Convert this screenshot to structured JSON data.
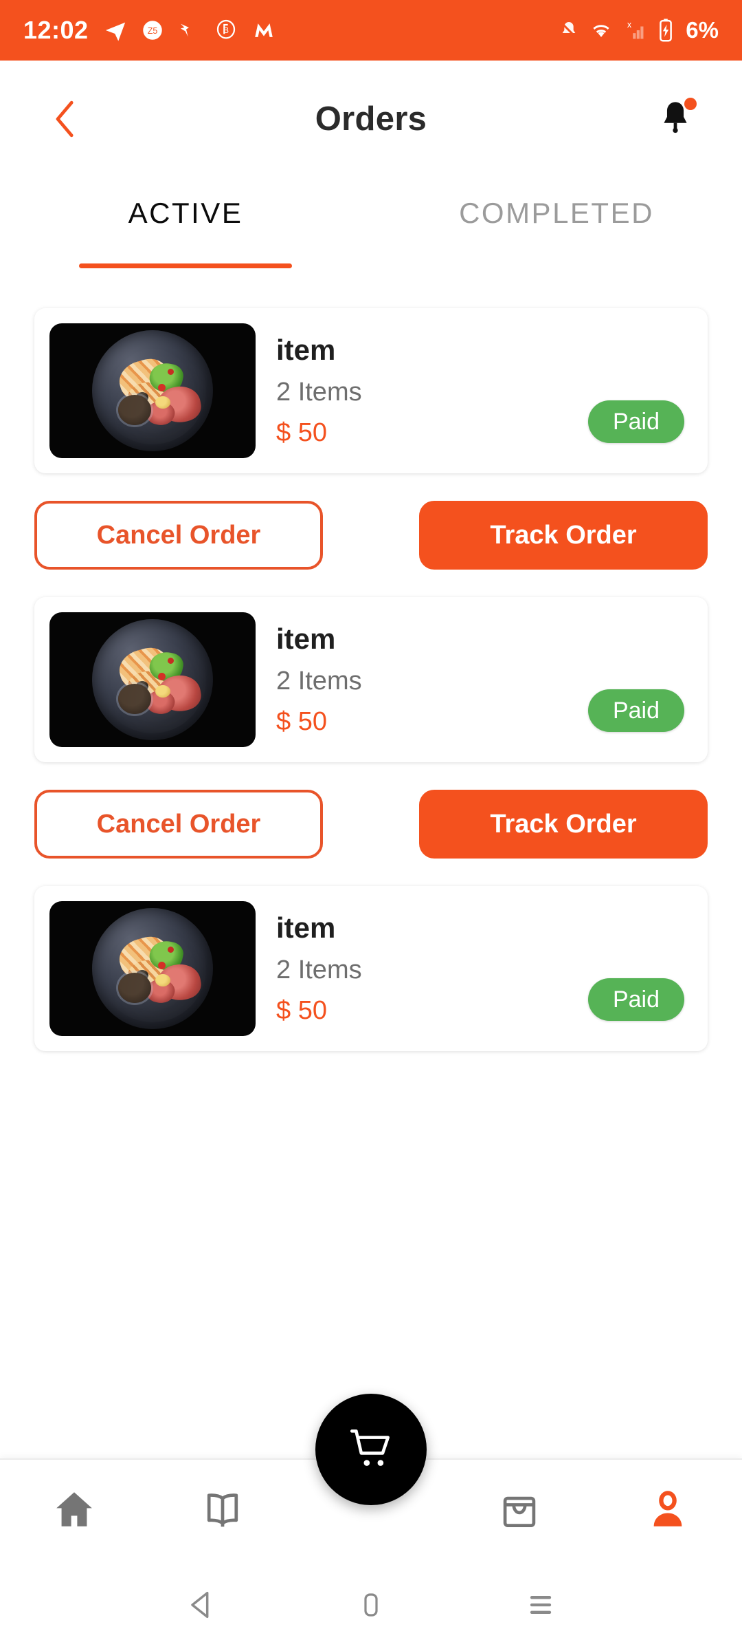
{
  "status_bar": {
    "time": "12:02",
    "battery_percent": "6%",
    "left_icons": [
      "telegram-icon",
      "zee5-icon",
      "bird-app-icon",
      "b-badge-icon",
      "m-app-icon"
    ],
    "right_icons": [
      "bell-muted-icon",
      "wifi-icon",
      "signal-no-sim-icon",
      "battery-charging-icon"
    ],
    "background_color": "#F4511E"
  },
  "header": {
    "title": "Orders",
    "back_icon": "chevron-left-icon",
    "notification_icon": "bell-icon",
    "has_notification_dot": true
  },
  "tabs": [
    {
      "label": "ACTIVE",
      "active": true
    },
    {
      "label": "COMPLETED",
      "active": false
    }
  ],
  "orders": [
    {
      "name": "item",
      "count": "2 Items",
      "price": "$ 50",
      "status": "Paid",
      "cancel_label": "Cancel Order",
      "track_label": "Track Order"
    },
    {
      "name": "item",
      "count": "2 Items",
      "price": "$ 50",
      "status": "Paid",
      "cancel_label": "Cancel Order",
      "track_label": "Track Order"
    },
    {
      "name": "item",
      "count": "2 Items",
      "price": "$ 50",
      "status": "Paid",
      "cancel_label": "Cancel Order",
      "track_label": "Track Order"
    }
  ],
  "bottom_nav": {
    "items": [
      {
        "icon": "home-icon",
        "active": false
      },
      {
        "icon": "book-icon",
        "active": false
      },
      {
        "icon": "shopping-bag-icon",
        "active": false
      },
      {
        "icon": "person-icon",
        "active": true
      }
    ],
    "fab_icon": "shopping-cart-icon",
    "active_color": "#F4511E",
    "inactive_color": "#757575"
  },
  "system_nav": {
    "back_icon": "triangle-back-icon",
    "home_icon": "home-square-icon",
    "recents_icon": "menu-lines-icon"
  },
  "colors": {
    "accent": "#F4511E",
    "paid_green": "#56B356",
    "muted_text": "#6E6E6E"
  }
}
